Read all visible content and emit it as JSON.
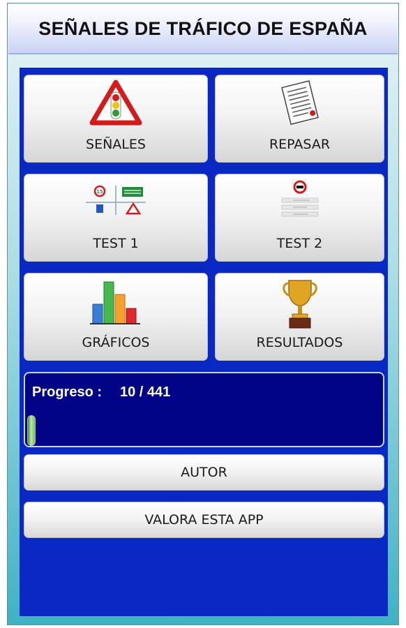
{
  "header": {
    "title": "SEÑALES DE TRÁFICO DE ESPAÑA"
  },
  "tiles": [
    {
      "label": "SEÑALES",
      "icon": "warning-triangle-traffic-light-icon"
    },
    {
      "label": "REPASAR",
      "icon": "checklist-document-icon"
    },
    {
      "label": "TEST 1",
      "icon": "road-signs-test-icon"
    },
    {
      "label": "TEST 2",
      "icon": "sign-quiz-list-icon"
    },
    {
      "label": "GRÁFICOS",
      "icon": "bar-chart-icon"
    },
    {
      "label": "RESULTADOS",
      "icon": "trophy-icon"
    }
  ],
  "progress": {
    "label": "Progreso :",
    "value_text": "10 / 441",
    "current": 10,
    "total": 441
  },
  "buttons": {
    "author": "AUTOR",
    "rate": "VALORA ESTA APP"
  },
  "colors": {
    "content_background": "#0a28c4",
    "progress_panel": "#020487",
    "progress_fill": "#7cc267"
  }
}
